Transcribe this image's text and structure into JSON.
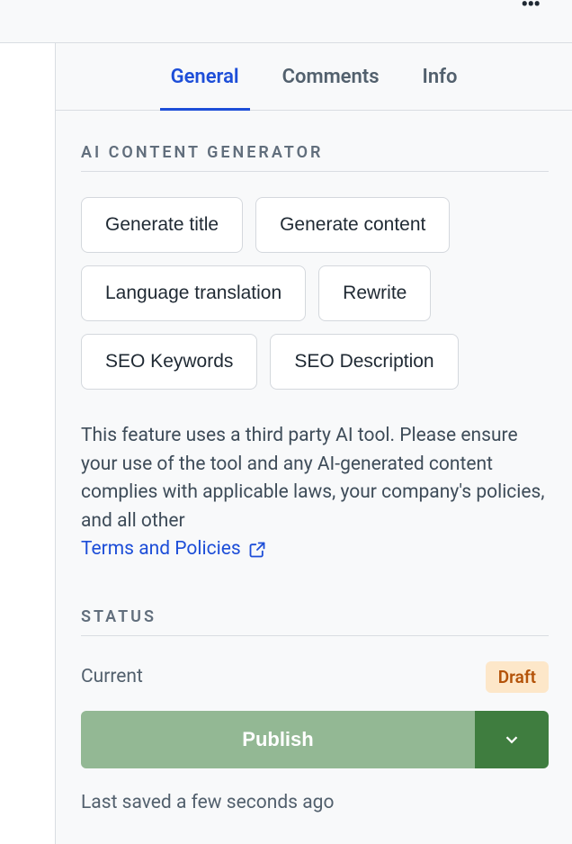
{
  "tabs": {
    "general": "General",
    "comments": "Comments",
    "info": "Info"
  },
  "ai": {
    "title": "AI CONTENT GENERATOR",
    "buttons": {
      "generate_title": "Generate title",
      "generate_content": "Generate content",
      "language_translation": "Language translation",
      "rewrite": "Rewrite",
      "seo_keywords": "SEO Keywords",
      "seo_description": "SEO Description"
    },
    "disclaimer": "This feature uses a third party AI tool. Please ensure your use of the tool and any AI-generated content complies with applicable laws, your company's policies, and all other",
    "terms_link": "Terms and Policies"
  },
  "status": {
    "title": "STATUS",
    "current_label": "Current",
    "badge": "Draft",
    "publish_label": "Publish",
    "last_saved": "Last saved a few seconds ago"
  }
}
